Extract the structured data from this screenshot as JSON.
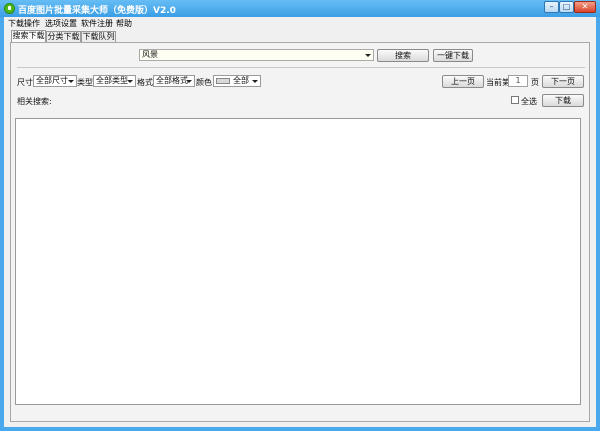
{
  "window": {
    "title": "百度图片批量采集大师（免费版）V2.0",
    "minimize": "–",
    "maximize": "□",
    "close": "✕"
  },
  "menu": [
    "下载操作",
    "选项设置",
    "软件注册",
    "帮助"
  ],
  "tabs": [
    "搜索下载",
    "分类下载",
    "下载队列"
  ],
  "search": {
    "keyword": "风景",
    "search_button": "搜索",
    "download_all_button": "一键下载"
  },
  "filters": {
    "size_label": "尺寸",
    "size_value": "全部尺寸",
    "type_label": "类型",
    "type_value": "全部类型",
    "format_label": "格式",
    "format_value": "全部格式",
    "color_label": "颜色",
    "color_value": "全部"
  },
  "paging": {
    "prev_button": "上一页",
    "current_label": "当前第",
    "page_number": "1",
    "page_unit": "页",
    "next_button": "下一页"
  },
  "related": {
    "label": "相关搜索:",
    "select_all": "全选",
    "download_button": "下载"
  }
}
